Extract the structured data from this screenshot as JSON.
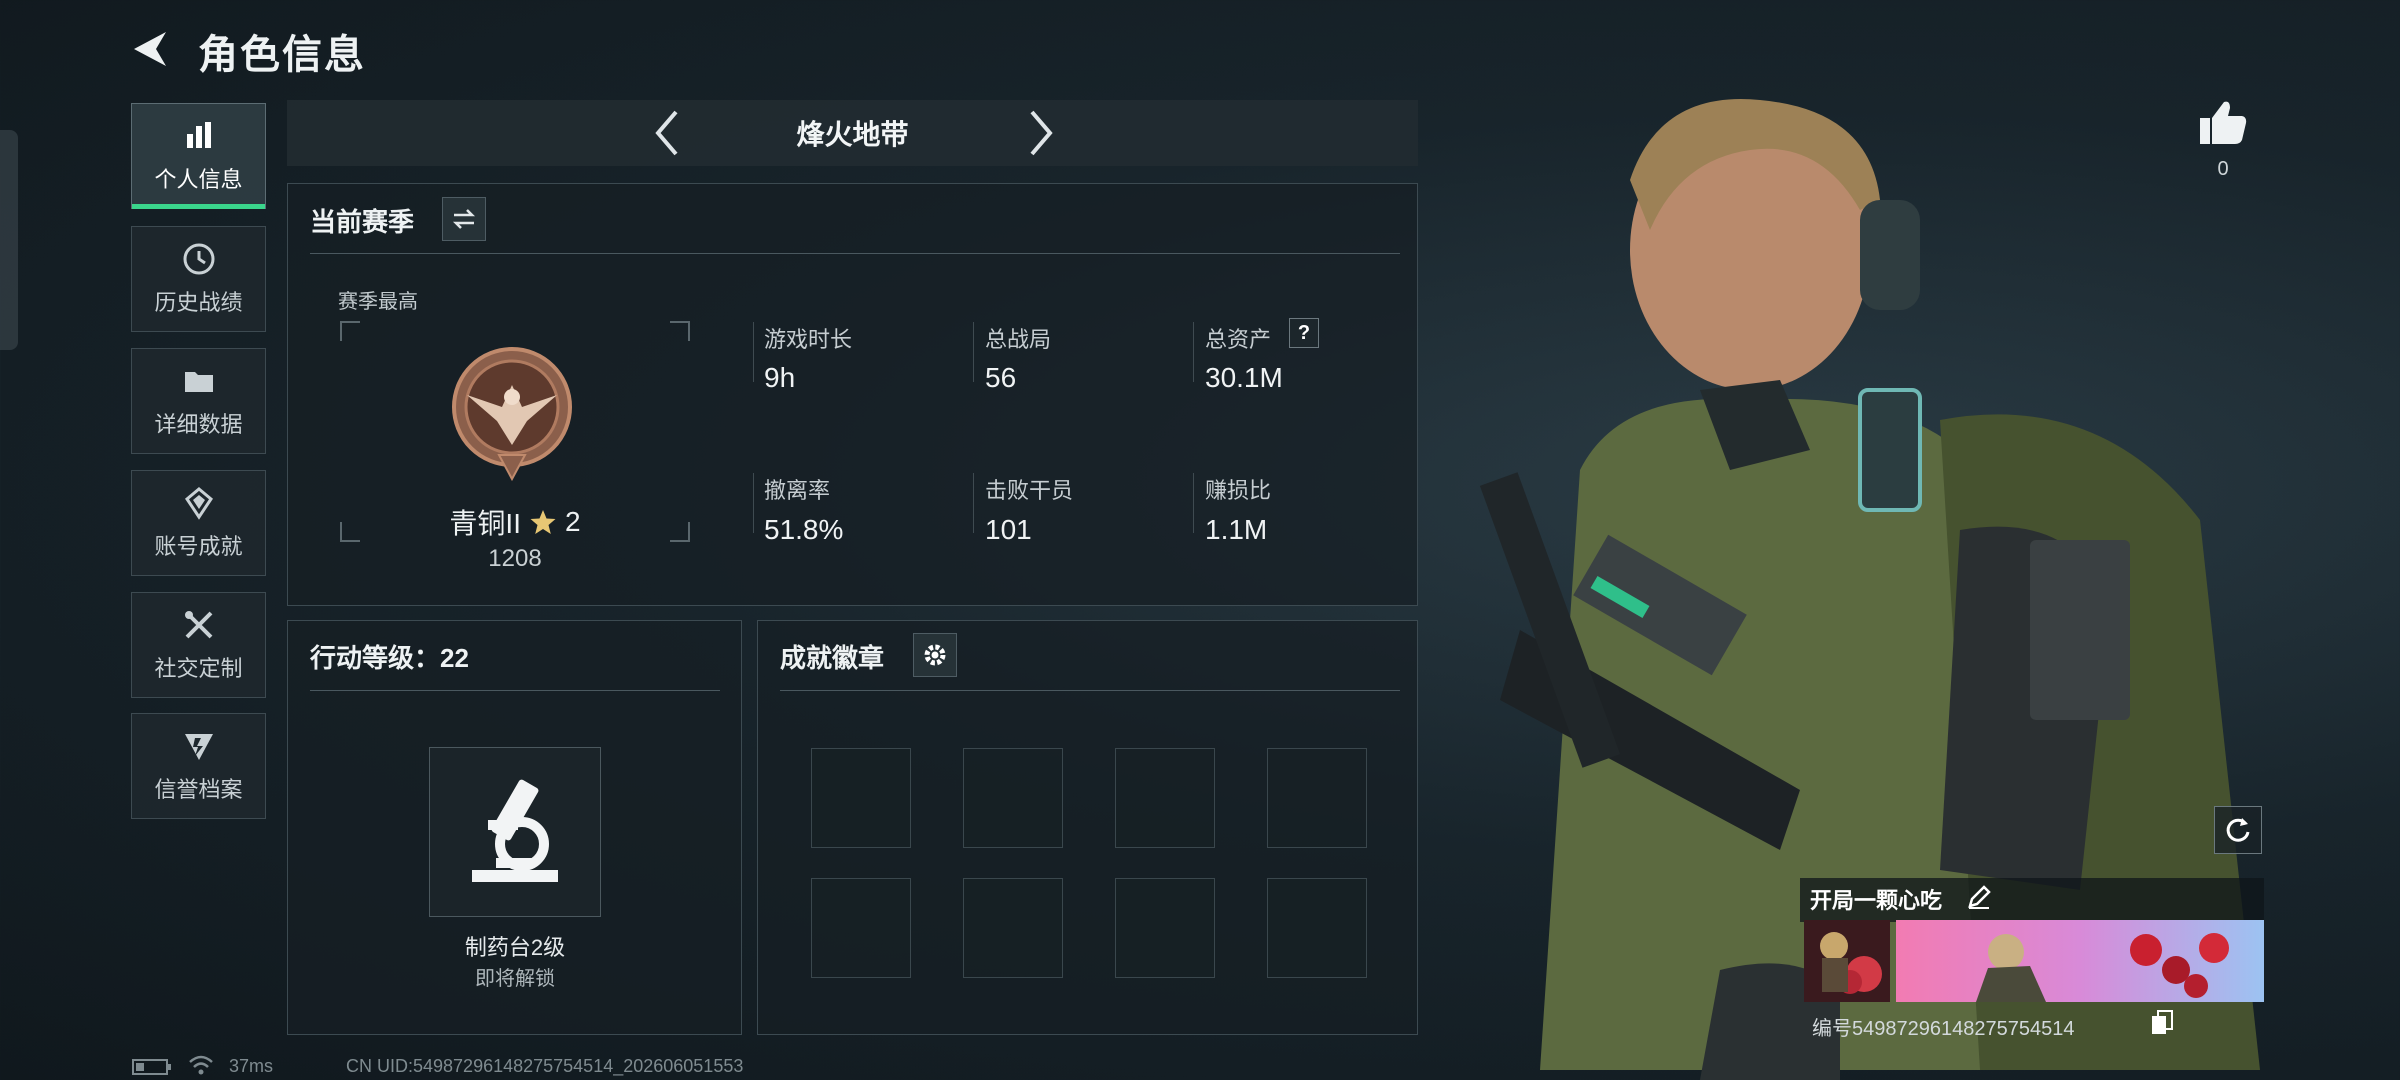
{
  "header": {
    "title": "角色信息"
  },
  "sidebar": {
    "items": [
      {
        "label": "个人信息",
        "icon": "bar-chart-icon",
        "active": true
      },
      {
        "label": "历史战绩",
        "icon": "clock-icon"
      },
      {
        "label": "详细数据",
        "icon": "folder-icon"
      },
      {
        "label": "账号成就",
        "icon": "achievement-icon"
      },
      {
        "label": "社交定制",
        "icon": "tools-icon"
      },
      {
        "label": "信誉档案",
        "icon": "shield-icon"
      }
    ]
  },
  "mode": {
    "title": "烽火地带"
  },
  "season": {
    "title": "当前赛季",
    "peak_label": "赛季最高",
    "rank_name": "青铜II",
    "rank_stars": "2",
    "rank_points": "1208",
    "stats": [
      {
        "label": "游戏时长",
        "value": "9h"
      },
      {
        "label": "总战局",
        "value": "56"
      },
      {
        "label": "总资产",
        "value": "30.1M"
      },
      {
        "label": "撤离率",
        "value": "51.8%"
      },
      {
        "label": "击败干员",
        "value": "101"
      },
      {
        "label": "赚损比",
        "value": "1.1M"
      }
    ]
  },
  "level": {
    "title": "行动等级：22",
    "unlock_name": "制药台2级",
    "unlock_status": "即将解锁"
  },
  "badges": {
    "title": "成就徽章"
  },
  "profile": {
    "likes": "0",
    "player_name": "开局一颗心吃",
    "uid_line": "编号54987296148275754514"
  },
  "status_bar": {
    "ping": "37ms",
    "uid": "CN UID:54987296148275754514_202606051553"
  },
  "colors": {
    "accent": "#3ad68c",
    "panel_border": "#3c4a51",
    "background": "#18242b"
  }
}
